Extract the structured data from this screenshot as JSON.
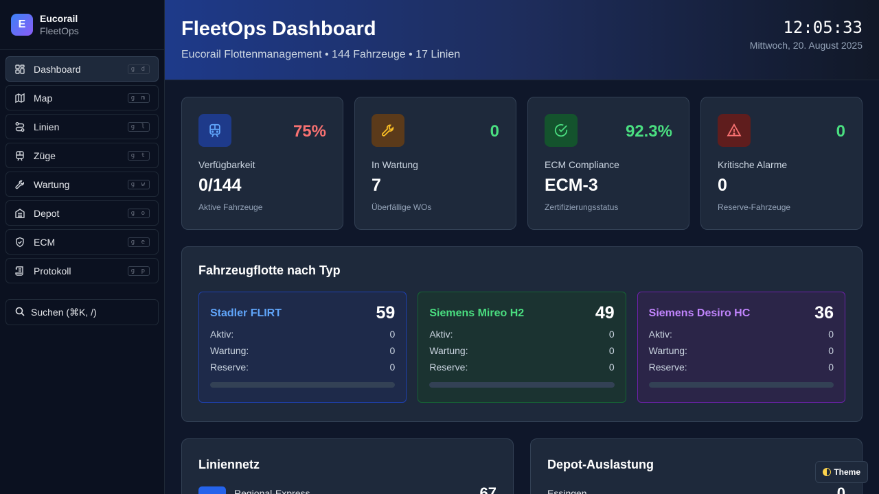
{
  "brand": {
    "logo": "E",
    "name": "Eucorail",
    "sub": "FleetOps"
  },
  "nav": [
    {
      "label": "Dashboard",
      "kbd": "g d",
      "icon": "grid-icon",
      "active": true
    },
    {
      "label": "Map",
      "kbd": "g m",
      "icon": "map-icon"
    },
    {
      "label": "Linien",
      "kbd": "g l",
      "icon": "route-icon"
    },
    {
      "label": "Züge",
      "kbd": "g t",
      "icon": "train-icon"
    },
    {
      "label": "Wartung",
      "kbd": "g w",
      "icon": "wrench-icon"
    },
    {
      "label": "Depot",
      "kbd": "g o",
      "icon": "depot-icon"
    },
    {
      "label": "ECM",
      "kbd": "g e",
      "icon": "shield-icon"
    },
    {
      "label": "Protokoll",
      "kbd": "g p",
      "icon": "scroll-icon"
    }
  ],
  "search": {
    "label": "Suchen (⌘K, /)"
  },
  "header": {
    "title": "FleetOps Dashboard",
    "subtitle": "Eucorail Flottenmanagement • 144 Fahrzeuge • 17 Linien",
    "clock": "12:05:33",
    "date": "Mittwoch, 20. August 2025"
  },
  "kpis": [
    {
      "value": "75%",
      "label": "Verfügbarkeit",
      "main": "0/144",
      "sub": "Aktive Fahrzeuge",
      "icon": "train-icon",
      "value_color": "#f87171",
      "icon_bg": "#1e3a8a",
      "icon_color": "#60a5fa"
    },
    {
      "value": "0",
      "label": "In Wartung",
      "main": "7",
      "sub": "Überfällige WOs",
      "icon": "wrench-icon",
      "value_color": "#4ade80",
      "icon_bg": "#5b3a1a",
      "icon_color": "#fbbf24"
    },
    {
      "value": "92.3%",
      "label": "ECM Compliance",
      "main": "ECM-3",
      "sub": "Zertifizierungsstatus",
      "icon": "check-circle-icon",
      "value_color": "#4ade80",
      "icon_bg": "#14532d",
      "icon_color": "#4ade80"
    },
    {
      "value": "0",
      "label": "Kritische Alarme",
      "main": "0",
      "sub": "Reserve-Fahrzeuge",
      "icon": "alert-triangle-icon",
      "value_color": "#4ade80",
      "icon_bg": "#5f1d1d",
      "icon_color": "#f87171"
    }
  ],
  "fleet": {
    "title": "Fahrzeugflotte nach Typ",
    "row_labels": {
      "active": "Aktiv:",
      "maintenance": "Wartung:",
      "reserve": "Reserve:"
    },
    "types": [
      {
        "name": "Stadler FLIRT",
        "count": "59",
        "active": "0",
        "maintenance": "0",
        "reserve": "0",
        "color": "#60a5fa",
        "bg": "#1e2a4a",
        "border": "#1e40af"
      },
      {
        "name": "Siemens Mireo H2",
        "count": "49",
        "active": "0",
        "maintenance": "0",
        "reserve": "0",
        "color": "#4ade80",
        "bg": "#1b3331",
        "border": "#166534"
      },
      {
        "name": "Siemens Desiro HC",
        "count": "36",
        "active": "0",
        "maintenance": "0",
        "reserve": "0",
        "color": "#c084fc",
        "bg": "#2b2548",
        "border": "#6b21a8"
      }
    ]
  },
  "lines": {
    "title": "Liniennetz",
    "first_line": "Regional-Express",
    "first_count": "67"
  },
  "depot": {
    "title": "Depot-Auslastung",
    "first_row": "Essingen",
    "first_value": "0"
  },
  "theme": {
    "label": "Theme"
  }
}
